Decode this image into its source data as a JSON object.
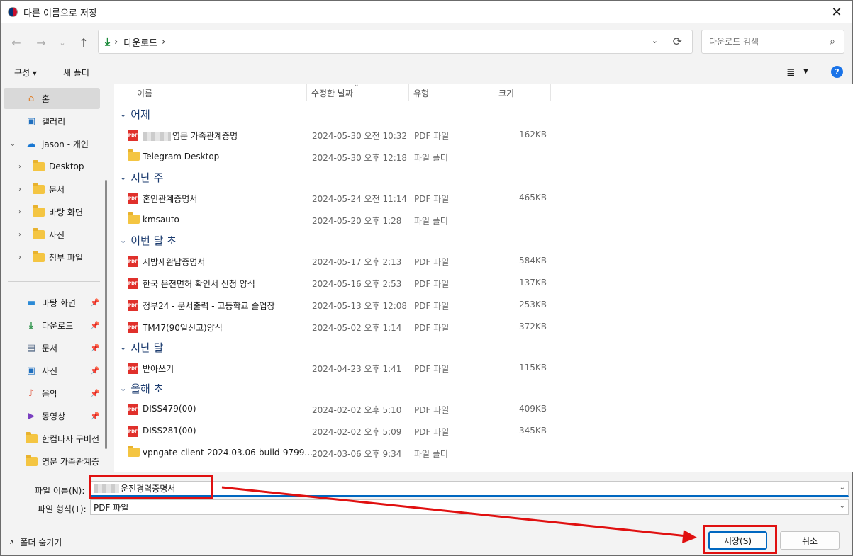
{
  "window": {
    "title": "다른 이름으로 저장"
  },
  "nav": {
    "breadcrumb": "다운로드",
    "search_placeholder": "다운로드 검색"
  },
  "toolbar": {
    "organize": "구성 ▾",
    "new_folder": "새 폴더"
  },
  "sidebar": {
    "items": [
      {
        "label": "홈",
        "icon": "home-icon"
      },
      {
        "label": "갤러리",
        "icon": "gallery-icon"
      },
      {
        "label": "jason - 개인",
        "icon": "onedrive-cloud-icon"
      },
      {
        "label": "Desktop",
        "icon": "folder-icon"
      },
      {
        "label": "문서",
        "icon": "folder-icon"
      },
      {
        "label": "바탕 화면",
        "icon": "folder-icon"
      },
      {
        "label": "사진",
        "icon": "folder-icon"
      },
      {
        "label": "첨부 파일",
        "icon": "folder-icon"
      }
    ],
    "quick": [
      {
        "label": "바탕 화면",
        "icon": "desktop-icon"
      },
      {
        "label": "다운로드",
        "icon": "download-icon"
      },
      {
        "label": "문서",
        "icon": "document-icon"
      },
      {
        "label": "사진",
        "icon": "pictures-icon"
      },
      {
        "label": "음악",
        "icon": "music-icon"
      },
      {
        "label": "동영상",
        "icon": "video-icon"
      },
      {
        "label": "한컴타자 구버전",
        "icon": "folder-icon"
      },
      {
        "label": "영문 가족관계증",
        "icon": "folder-icon"
      }
    ]
  },
  "columns": {
    "name": "이름",
    "modified": "수정한 날짜",
    "type": "유형",
    "size": "크기"
  },
  "groups": [
    {
      "label": "어제"
    },
    {
      "label": "지난 주"
    },
    {
      "label": "이번 달 초"
    },
    {
      "label": "지난 달"
    },
    {
      "label": "올해 초"
    }
  ],
  "files": [
    {
      "name": "영문 가족관계증명",
      "date": "2024-05-30 오전 10:32",
      "type": "PDF 파일",
      "size": "162KB",
      "kind": "pdf"
    },
    {
      "name": "Telegram Desktop",
      "date": "2024-05-30 오후 12:18",
      "type": "파일 폴더",
      "size": "",
      "kind": "folder"
    },
    {
      "name": "혼인관계증명서",
      "date": "2024-05-24 오전 11:14",
      "type": "PDF 파일",
      "size": "465KB",
      "kind": "pdf"
    },
    {
      "name": "kmsauto",
      "date": "2024-05-20 오후 1:28",
      "type": "파일 폴더",
      "size": "",
      "kind": "folder"
    },
    {
      "name": "지방세완납증명서",
      "date": "2024-05-17 오후 2:13",
      "type": "PDF 파일",
      "size": "584KB",
      "kind": "pdf"
    },
    {
      "name": "한국 운전면허 확인서 신청 양식",
      "date": "2024-05-16 오후 2:53",
      "type": "PDF 파일",
      "size": "137KB",
      "kind": "pdf"
    },
    {
      "name": "정부24 - 문서출력 - 고등학교 졸업장",
      "date": "2024-05-13 오후 12:08",
      "type": "PDF 파일",
      "size": "253KB",
      "kind": "pdf"
    },
    {
      "name": "TM47(90일신고)양식",
      "date": "2024-05-02 오후 1:14",
      "type": "PDF 파일",
      "size": "372KB",
      "kind": "pdf"
    },
    {
      "name": "받아쓰기",
      "date": "2024-04-23 오후 1:41",
      "type": "PDF 파일",
      "size": "115KB",
      "kind": "pdf"
    },
    {
      "name": "DISS479(00)",
      "date": "2024-02-02 오후 5:10",
      "type": "PDF 파일",
      "size": "409KB",
      "kind": "pdf"
    },
    {
      "name": "DISS281(00)",
      "date": "2024-02-02 오후 5:09",
      "type": "PDF 파일",
      "size": "345KB",
      "kind": "pdf"
    },
    {
      "name": "vpngate-client-2024.03.06-build-9799....",
      "date": "2024-03-06 오후 9:34",
      "type": "파일 폴더",
      "size": "",
      "kind": "folder"
    }
  ],
  "form": {
    "filename_label": "파일 이름(N):",
    "filename_value": "운전경력증명서",
    "filetype_label": "파일 형식(T):",
    "filetype_value": "PDF 파일"
  },
  "footer": {
    "hide_folders": "폴더 숨기기",
    "save": "저장(S)",
    "cancel": "취소"
  },
  "colors": {
    "accent": "#0067c0",
    "annotation": "#e01010",
    "pdf": "#e0302b",
    "folder": "#f4c542"
  }
}
